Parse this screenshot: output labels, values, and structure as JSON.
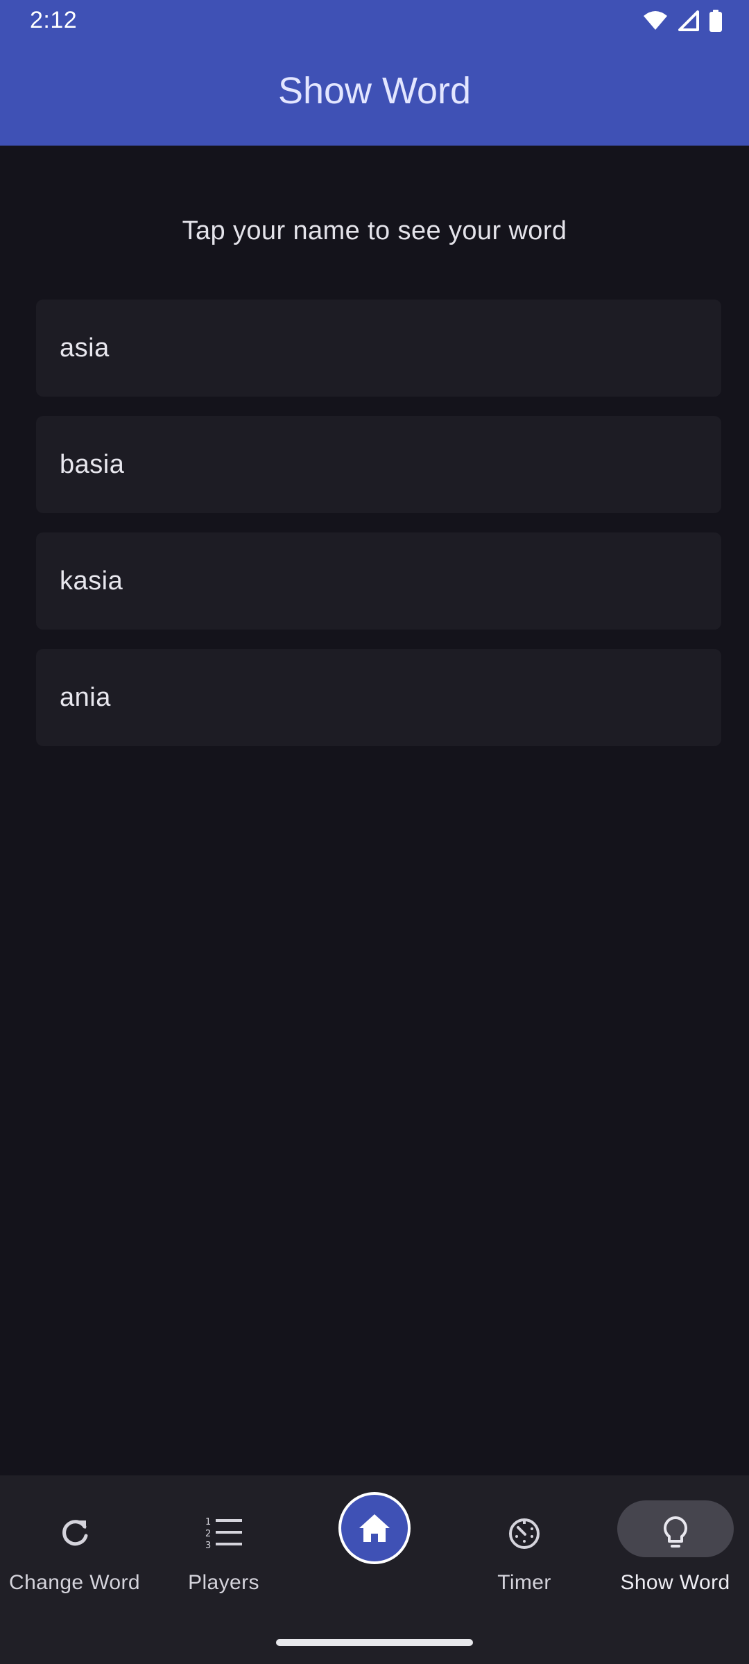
{
  "status_bar": {
    "time": "2:12"
  },
  "app_bar": {
    "title": "Show Word"
  },
  "content": {
    "subtitle": "Tap your name to see your word",
    "players": [
      "asia",
      "basia",
      "kasia",
      "ania"
    ]
  },
  "bottom_nav": {
    "items": [
      {
        "label": "Change Word",
        "icon": "refresh-icon"
      },
      {
        "label": "Players",
        "icon": "numbered-list-icon"
      },
      {
        "label": "",
        "icon": "home-icon"
      },
      {
        "label": "Timer",
        "icon": "timer-icon"
      },
      {
        "label": "Show Word",
        "icon": "lightbulb-icon",
        "active": true
      }
    ]
  },
  "colors": {
    "primary": "#3f51b5",
    "background": "#14131b",
    "list_item": "#1d1c24",
    "nav_background": "#201f26",
    "active_pill": "#46454e"
  }
}
